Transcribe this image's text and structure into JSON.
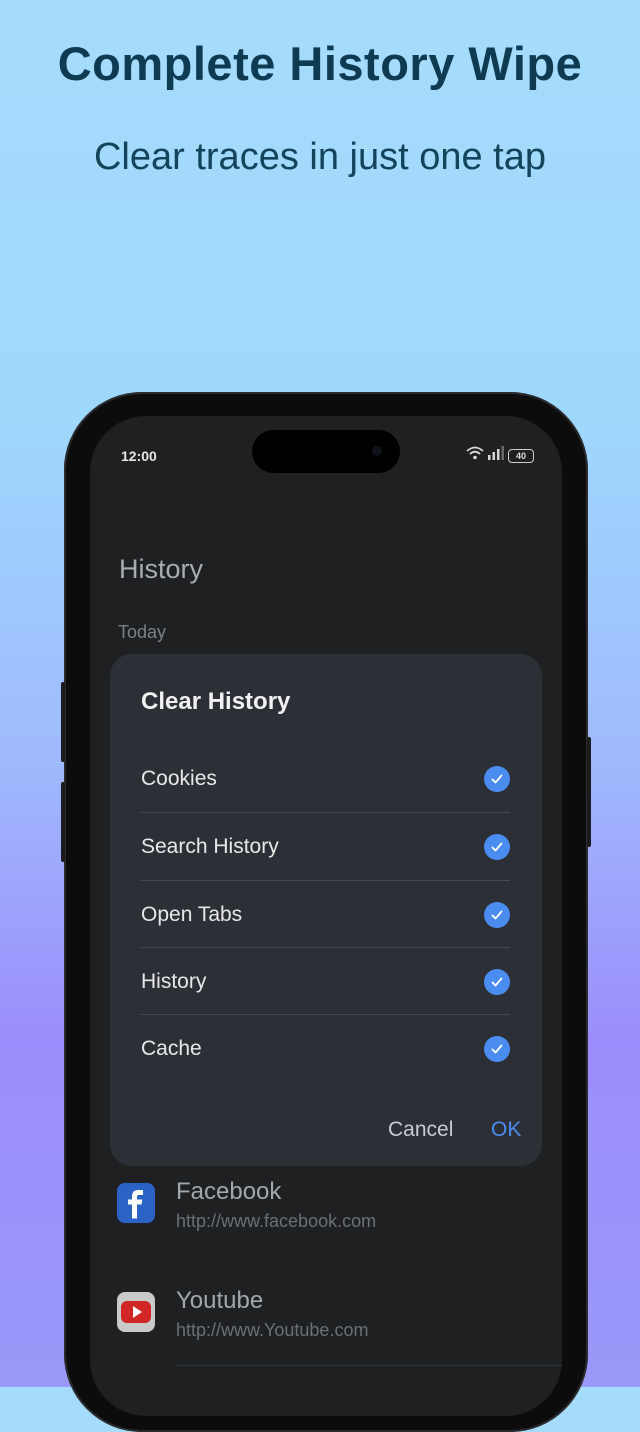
{
  "promo": {
    "headline": "Complete History Wipe",
    "subline": "Clear traces in just one tap"
  },
  "status_bar": {
    "time": "12:00",
    "battery": "40",
    "icons": [
      "wifi-icon",
      "signal-icon",
      "battery-icon"
    ]
  },
  "screen": {
    "title": "History",
    "section": "Today"
  },
  "dialog": {
    "title": "Clear History",
    "options": [
      {
        "label": "Cookies",
        "checked": true
      },
      {
        "label": "Search History",
        "checked": true
      },
      {
        "label": "Open Tabs",
        "checked": true
      },
      {
        "label": "History",
        "checked": true
      },
      {
        "label": "Cache",
        "checked": true
      }
    ],
    "cancel_label": "Cancel",
    "ok_label": "OK"
  },
  "history": [
    {
      "name": "Facebook",
      "url": "http://www.facebook.com",
      "icon": "facebook-icon"
    },
    {
      "name": "Youtube",
      "url": "http://www.Youtube.com",
      "icon": "youtube-icon"
    }
  ],
  "colors": {
    "accent": "#4a8cf0",
    "dialog_bg": "#2c3036",
    "screen_bg": "#1e2022",
    "headline": "#0e3a52"
  }
}
